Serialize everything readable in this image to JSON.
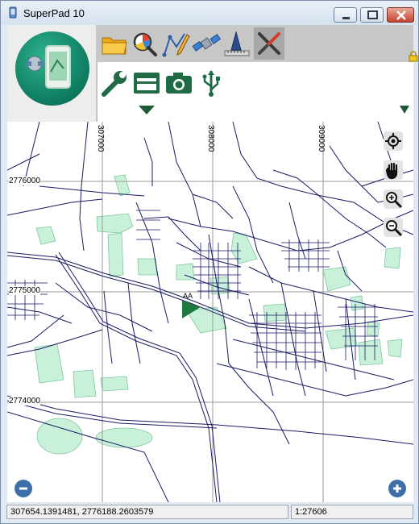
{
  "window": {
    "title": "SuperPad 10"
  },
  "toolbar": {
    "row1": [
      {
        "name": "open-folder-button",
        "icon": "folder-icon"
      },
      {
        "name": "query-button",
        "icon": "magnifier-chart-icon"
      },
      {
        "name": "edit-button",
        "icon": "pencil-vertex-icon"
      },
      {
        "name": "gps-button",
        "icon": "satellite-icon"
      },
      {
        "name": "measure-button",
        "icon": "ruler-triangle-icon"
      },
      {
        "name": "tools-button",
        "icon": "wrench-screwdriver-icon",
        "active": true
      }
    ],
    "row2": [
      {
        "name": "settings-button",
        "icon": "wrench-icon"
      },
      {
        "name": "layout-button",
        "icon": "panel-icon"
      },
      {
        "name": "camera-button",
        "icon": "camera-icon"
      },
      {
        "name": "usb-button",
        "icon": "usb-icon"
      }
    ]
  },
  "map": {
    "grid_x": [
      "307000",
      "308000",
      "309000"
    ],
    "grid_y": [
      "2776000",
      "2775000",
      "2774000"
    ],
    "marker_label": "AA",
    "controls": [
      "locate-icon",
      "pan-hand-icon",
      "zoom-in-icon",
      "zoom-out-icon"
    ]
  },
  "status": {
    "coordinates": "307654.1391481, 2776188.2603579",
    "scale": "1:27606"
  },
  "colors": {
    "road": "#1a1a66",
    "park": "#c7f0d8",
    "accent": "#1e7a4e"
  }
}
